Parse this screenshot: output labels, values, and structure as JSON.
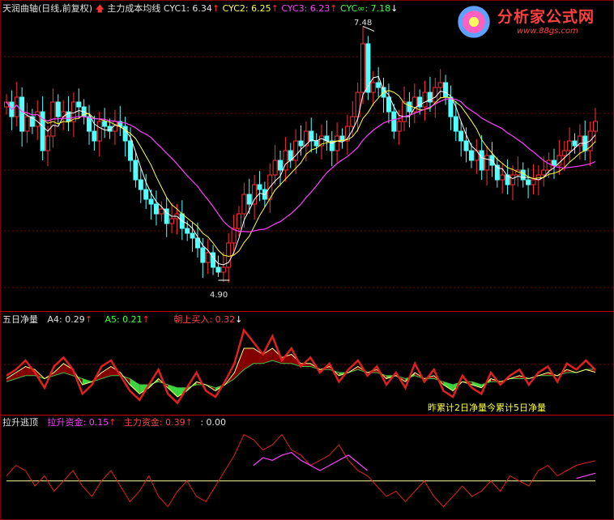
{
  "panel_main": {
    "title": "天润曲轴(日线,前复权)",
    "indicator": "主力成本均线",
    "cyc1_label": "CYC1: 6.34",
    "cyc2_label": "CYC2: 6.25",
    "cyc3_label": "CYC3: 6.23",
    "cycinf_label": "CYC∞: 7.18",
    "high_label": "7.48",
    "low_label": "4.90"
  },
  "panel_mid": {
    "title": "五日净量",
    "a4_label": "A4: 0.29",
    "a5_label": "A5: 0.21",
    "buy_label": "朝上买入: 0.32",
    "note": "昨累计2日净量今累计5日净量"
  },
  "panel_low": {
    "title": "拉升逃顶",
    "lift_label": "拉升资金: 0.15",
    "main_label": "主力资金: 0.39",
    "zero_label": ": 0.00"
  },
  "logo": {
    "text": "分析家公式网",
    "url": "www.88gs.com"
  },
  "colors": {
    "up": "#ff3030",
    "down": "#54ffff",
    "cyc1": "#ffffff",
    "cyc2": "#ffff40",
    "cyc3": "#ff40ff",
    "grid": "#800000"
  },
  "chart_data": [
    {
      "type": "candlestick",
      "title": "天润曲轴(日线,前复权)",
      "ylim": [
        4.6,
        7.6
      ],
      "annotations": {
        "high": 7.48,
        "low": 4.9
      },
      "closes": [
        6.7,
        6.55,
        6.75,
        6.4,
        6.55,
        6.45,
        6.6,
        6.2,
        6.35,
        6.7,
        6.55,
        6.6,
        6.5,
        6.7,
        6.65,
        6.55,
        6.4,
        6.3,
        6.5,
        6.45,
        6.4,
        6.5,
        6.45,
        6.3,
        6.1,
        5.9,
        5.8,
        5.7,
        5.65,
        5.55,
        5.6,
        5.45,
        5.5,
        5.55,
        5.4,
        5.35,
        5.3,
        5.2,
        5.05,
        5.15,
        5.0,
        4.95,
        5.0,
        5.25,
        5.4,
        5.55,
        5.75,
        5.65,
        5.85,
        5.8,
        5.7,
        5.95,
        6.1,
        6.0,
        6.2,
        6.1,
        6.3,
        6.25,
        6.4,
        6.3,
        6.25,
        6.35,
        6.3,
        6.2,
        6.35,
        6.3,
        6.45,
        6.55,
        6.8,
        7.3,
        6.8,
        6.9,
        6.85,
        6.75,
        6.6,
        6.4,
        6.5,
        6.7,
        6.6,
        6.75,
        6.65,
        6.8,
        6.7,
        6.85,
        6.9,
        6.75,
        6.55,
        6.4,
        6.3,
        6.2,
        6.1,
        6.2,
        6.0,
        6.15,
        6.05,
        5.9,
        5.95,
        5.85,
        5.95,
        6.0,
        5.9,
        5.85,
        5.9,
        5.95,
        6.0,
        6.1,
        6.05,
        6.15,
        6.2,
        6.3,
        6.25,
        6.35,
        6.2,
        6.4,
        6.5
      ]
    },
    {
      "type": "area",
      "title": "五日净量",
      "series": [
        {
          "name": "A4",
          "values": [
            0.1,
            0.3,
            0.6,
            0.2,
            -0.3,
            0.4,
            0.7,
            0.3,
            -0.5,
            -0.2,
            0.4,
            0.6,
            0.1,
            -0.4,
            -0.7,
            -0.2,
            0.3,
            -0.5,
            -0.8,
            -0.3,
            0.2,
            -0.4,
            -0.6,
            -0.1,
            0.5,
            1.6,
            1.2,
            0.8,
            1.4,
            0.6,
            1.0,
            0.4,
            0.7,
            0.2,
            0.5,
            -0.1,
            0.3,
            0.6,
            0.1,
            0.4,
            -0.2,
            0.2,
            -0.3,
            0.5,
            -0.1,
            0.3,
            -0.4,
            -0.6,
            0.1,
            -0.3,
            -0.5,
            0.2,
            -0.2,
            0.1,
            0.3,
            -0.2,
            0.2,
            0.4,
            -0.1,
            0.5,
            0.3,
            0.6,
            0.29
          ]
        },
        {
          "name": "A5",
          "values": [
            0.0,
            0.2,
            0.4,
            0.3,
            0.0,
            0.2,
            0.5,
            0.3,
            -0.2,
            -0.1,
            0.2,
            0.4,
            0.2,
            -0.2,
            -0.5,
            -0.3,
            0.0,
            -0.3,
            -0.6,
            -0.4,
            -0.1,
            -0.2,
            -0.4,
            -0.2,
            0.2,
            1.0,
            1.0,
            0.8,
            1.0,
            0.7,
            0.8,
            0.5,
            0.5,
            0.3,
            0.4,
            0.1,
            0.2,
            0.4,
            0.2,
            0.3,
            0.0,
            0.1,
            -0.1,
            0.2,
            0.0,
            0.1,
            -0.2,
            -0.4,
            -0.1,
            -0.2,
            -0.3,
            0.0,
            -0.1,
            0.0,
            0.1,
            0.0,
            0.1,
            0.2,
            0.1,
            0.3,
            0.2,
            0.3,
            0.21
          ]
        },
        {
          "name": "朝上买入",
          "values": [
            -0.1,
            0.0,
            0.1,
            0.1,
            0.0,
            0.1,
            0.2,
            0.1,
            0.0,
            -0.1,
            0.0,
            0.1,
            0.1,
            0.0,
            -0.2,
            -0.2,
            -0.1,
            -0.2,
            -0.3,
            -0.3,
            -0.2,
            -0.2,
            -0.3,
            -0.2,
            0.0,
            0.3,
            0.5,
            0.5,
            0.6,
            0.5,
            0.5,
            0.4,
            0.4,
            0.3,
            0.3,
            0.2,
            0.2,
            0.3,
            0.2,
            0.2,
            0.1,
            0.1,
            0.0,
            0.1,
            0.0,
            0.0,
            -0.1,
            -0.2,
            -0.1,
            -0.1,
            -0.2,
            -0.1,
            -0.1,
            0.0,
            0.0,
            0.0,
            0.1,
            0.1,
            0.1,
            0.2,
            0.2,
            0.3,
            0.32
          ]
        }
      ]
    },
    {
      "type": "line",
      "title": "拉升逃顶",
      "series": [
        {
          "name": "拉升资金",
          "values": [
            0,
            0,
            0,
            0,
            0,
            0,
            0,
            0,
            0,
            0,
            0,
            0,
            0,
            0,
            0,
            0,
            0,
            0,
            0,
            0,
            0,
            0,
            0,
            0,
            0,
            0,
            0.3,
            0.45,
            0.4,
            0.5,
            0.55,
            0.4,
            0.3,
            0.2,
            0.3,
            0.4,
            0.5,
            0.35,
            0.2,
            0,
            0,
            0,
            0,
            0,
            0,
            0,
            0,
            0,
            0,
            0,
            0,
            0,
            0,
            0,
            0,
            0,
            0,
            0,
            0,
            0,
            0.05,
            0.1,
            0.15
          ]
        },
        {
          "name": "主力资金",
          "values": [
            0.1,
            0.3,
            0.2,
            -0.1,
            0.1,
            -0.2,
            0.0,
            0.2,
            -0.1,
            -0.3,
            0.0,
            0.2,
            -0.1,
            -0.4,
            -0.2,
            0.1,
            -0.3,
            -0.5,
            -0.2,
            0.0,
            -0.3,
            -0.4,
            -0.1,
            0.2,
            0.5,
            0.9,
            0.8,
            0.6,
            0.7,
            0.9,
            0.6,
            0.5,
            0.3,
            0.4,
            0.5,
            0.7,
            0.4,
            0.2,
            0.1,
            -0.1,
            -0.3,
            -0.2,
            -0.4,
            -0.2,
            0.0,
            -0.3,
            -0.5,
            -0.3,
            -0.1,
            -0.3,
            -0.2,
            0.0,
            -0.2,
            0.1,
            0.0,
            -0.1,
            0.2,
            0.3,
            0.1,
            0.2,
            0.3,
            0.35,
            0.39
          ]
        }
      ]
    }
  ]
}
